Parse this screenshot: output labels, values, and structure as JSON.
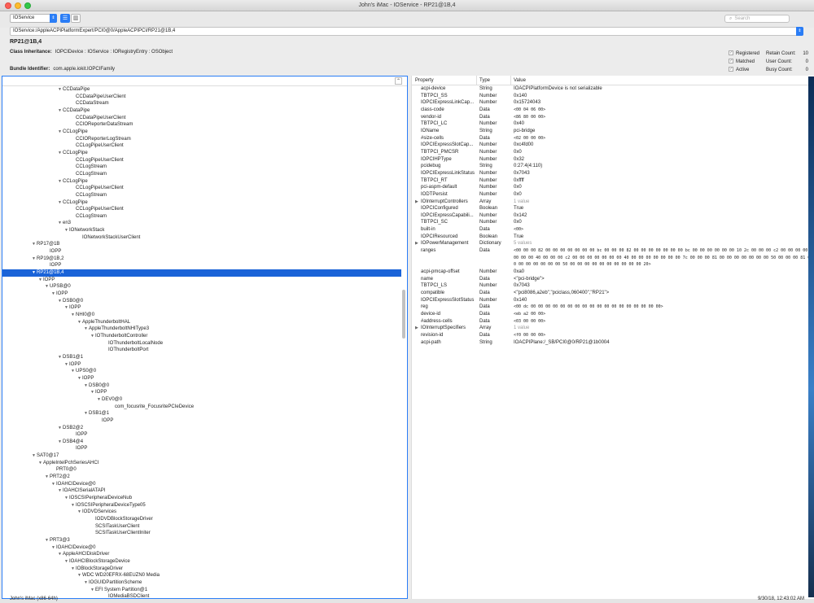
{
  "window": {
    "title": "John's iMac - IOService - RP21@1B,4"
  },
  "toolbar": {
    "plane_value": "IOService",
    "search_placeholder": "Search"
  },
  "path": "IOService:/AppleACPIPlatformExpert/PCI0@0/AppleACPIPCI/RP21@1B,4",
  "info": {
    "title": "RP21@1B,4",
    "class_label": "Class Inheritance:",
    "class_value": "IOPCIDevice : IOService : IORegistryEntry : OSObject",
    "bundle_label": "Bundle Identifier:",
    "bundle_value": "com.apple.iokit.IOPCIFamily",
    "flags": [
      "Registered",
      "Matched",
      "Active"
    ],
    "counts": [
      {
        "label": "Retain Count:",
        "value": "10"
      },
      {
        "label": "User Count:",
        "value": "0"
      },
      {
        "label": "Busy Count:",
        "value": "0"
      }
    ]
  },
  "tree": [
    {
      "d": 9,
      "t": "▼",
      "label": "CCDataPipe"
    },
    {
      "d": 11,
      "t": "",
      "label": "CCDataPipeUserClient"
    },
    {
      "d": 11,
      "t": "",
      "label": "CCDataStream"
    },
    {
      "d": 9,
      "t": "▼",
      "label": "CCDataPipe"
    },
    {
      "d": 11,
      "t": "",
      "label": "CCDataPipeUserClient"
    },
    {
      "d": 11,
      "t": "",
      "label": "CCIOReporterDataStream"
    },
    {
      "d": 9,
      "t": "▼",
      "label": "CCLogPipe"
    },
    {
      "d": 11,
      "t": "",
      "label": "CCIOReporterLogStream"
    },
    {
      "d": 11,
      "t": "",
      "label": "CCLogPipeUserClient"
    },
    {
      "d": 9,
      "t": "▼",
      "label": "CCLogPipe"
    },
    {
      "d": 11,
      "t": "",
      "label": "CCLogPipeUserClient"
    },
    {
      "d": 11,
      "t": "",
      "label": "CCLogStream"
    },
    {
      "d": 11,
      "t": "",
      "label": "CCLogStream"
    },
    {
      "d": 9,
      "t": "▼",
      "label": "CCLogPipe"
    },
    {
      "d": 11,
      "t": "",
      "label": "CCLogPipeUserClient"
    },
    {
      "d": 11,
      "t": "",
      "label": "CCLogStream"
    },
    {
      "d": 9,
      "t": "▼",
      "label": "CCLogPipe"
    },
    {
      "d": 11,
      "t": "",
      "label": "CCLogPipeUserClient"
    },
    {
      "d": 11,
      "t": "",
      "label": "CCLogStream"
    },
    {
      "d": 9,
      "t": "▼",
      "label": "en3"
    },
    {
      "d": 10,
      "t": "▼",
      "label": "IONetworkStack"
    },
    {
      "d": 12,
      "t": "",
      "label": "IONetworkStackUserClient"
    },
    {
      "d": 5,
      "t": "▼",
      "label": "RP17@1B"
    },
    {
      "d": 7,
      "t": "",
      "label": "IOPP"
    },
    {
      "d": 5,
      "t": "▼",
      "label": "RP19@1B,2"
    },
    {
      "d": 7,
      "t": "",
      "label": "IOPP"
    },
    {
      "d": 5,
      "t": "▼",
      "label": "RP21@1B,4",
      "sel": true
    },
    {
      "d": 6,
      "t": "▼",
      "label": "IOPP"
    },
    {
      "d": 7,
      "t": "▼",
      "label": "UPSB@0"
    },
    {
      "d": 8,
      "t": "▼",
      "label": "IOPP"
    },
    {
      "d": 9,
      "t": "▼",
      "label": "DSB0@0"
    },
    {
      "d": 10,
      "t": "▼",
      "label": "IOPP"
    },
    {
      "d": 11,
      "t": "▼",
      "label": "NHI0@0"
    },
    {
      "d": 12,
      "t": "▼",
      "label": "AppleThunderboltHAL"
    },
    {
      "d": 13,
      "t": "▼",
      "label": "AppleThunderboltNHIType3"
    },
    {
      "d": 14,
      "t": "▼",
      "label": "IOThunderboltController"
    },
    {
      "d": 16,
      "t": "",
      "label": "IOThunderboltLocalNode"
    },
    {
      "d": 16,
      "t": "",
      "label": "IOThunderboltPort"
    },
    {
      "d": 9,
      "t": "▼",
      "label": "DSB1@1"
    },
    {
      "d": 10,
      "t": "▼",
      "label": "IOPP"
    },
    {
      "d": 11,
      "t": "▼",
      "label": "UPS0@0"
    },
    {
      "d": 12,
      "t": "▼",
      "label": "IOPP"
    },
    {
      "d": 13,
      "t": "▼",
      "label": "DSB0@0"
    },
    {
      "d": 14,
      "t": "▼",
      "label": "IOPP"
    },
    {
      "d": 15,
      "t": "▼",
      "label": "DEV0@0"
    },
    {
      "d": 17,
      "t": "",
      "label": "com_focusrite_FocusritePCIeDevice"
    },
    {
      "d": 13,
      "t": "▼",
      "label": "DSB1@1"
    },
    {
      "d": 15,
      "t": "",
      "label": "IOPP"
    },
    {
      "d": 9,
      "t": "▼",
      "label": "DSB2@2"
    },
    {
      "d": 11,
      "t": "",
      "label": "IOPP"
    },
    {
      "d": 9,
      "t": "▼",
      "label": "DSB4@4"
    },
    {
      "d": 11,
      "t": "",
      "label": "IOPP"
    },
    {
      "d": 5,
      "t": "▼",
      "label": "SAT0@17"
    },
    {
      "d": 6,
      "t": "▼",
      "label": "AppleIntelPchSeriesAHCI"
    },
    {
      "d": 8,
      "t": "",
      "label": "PRT0@0"
    },
    {
      "d": 7,
      "t": "▼",
      "label": "PRT2@2"
    },
    {
      "d": 8,
      "t": "▼",
      "label": "IOAHCIDevice@0"
    },
    {
      "d": 9,
      "t": "▼",
      "label": "IOAHCISerialATAPI"
    },
    {
      "d": 10,
      "t": "▼",
      "label": "IOSCSIPeripheralDeviceNub"
    },
    {
      "d": 11,
      "t": "▼",
      "label": "IOSCSIPeripheralDeviceType05"
    },
    {
      "d": 12,
      "t": "▼",
      "label": "IODVDServices"
    },
    {
      "d": 14,
      "t": "",
      "label": "IODVDBlockStorageDriver"
    },
    {
      "d": 14,
      "t": "",
      "label": "SCSITaskUserClient"
    },
    {
      "d": 14,
      "t": "",
      "label": "SCSITaskUserClientIniter"
    },
    {
      "d": 7,
      "t": "▼",
      "label": "PRT3@3"
    },
    {
      "d": 8,
      "t": "▼",
      "label": "IOAHCIDevice@0"
    },
    {
      "d": 9,
      "t": "▼",
      "label": "AppleAHCIDiskDriver"
    },
    {
      "d": 10,
      "t": "▼",
      "label": "IOAHCIBlockStorageDevice"
    },
    {
      "d": 11,
      "t": "▼",
      "label": "IOBlockStorageDriver"
    },
    {
      "d": 12,
      "t": "▼",
      "label": "WDC WD20EFRX-68EUZN0 Media"
    },
    {
      "d": 13,
      "t": "▼",
      "label": "IOGUIDPartitionScheme"
    },
    {
      "d": 14,
      "t": "▼",
      "label": "EFI System Partition@1"
    },
    {
      "d": 16,
      "t": "",
      "label": "IOMediaBSDClient"
    }
  ],
  "props_header": {
    "property": "Property",
    "type": "Type",
    "value": "Value"
  },
  "props": [
    {
      "p": "acpi-device",
      "t": "String",
      "v": "IOACPIPlatformDevice is not serializable",
      "nm": true
    },
    {
      "p": "TBTPCI_SS",
      "t": "Number",
      "v": "0x140",
      "nm": true
    },
    {
      "p": "IOPCIExpressLinkCap...",
      "t": "Number",
      "v": "0x15724043",
      "nm": true
    },
    {
      "p": "class-code",
      "t": "Data",
      "v": "<00 04 06 00>"
    },
    {
      "p": "vendor-id",
      "t": "Data",
      "v": "<86 80 00 00>"
    },
    {
      "p": "TBTPCI_LC",
      "t": "Number",
      "v": "0x40",
      "nm": true
    },
    {
      "p": "IOName",
      "t": "String",
      "v": "pci-bridge",
      "nm": true
    },
    {
      "p": "#size-cells",
      "t": "Data",
      "v": "<02 00 00 00>"
    },
    {
      "p": "IOPCIExpressSlotCap...",
      "t": "Number",
      "v": "0xc4fd00",
      "nm": true
    },
    {
      "p": "TBTPCI_PMCSR",
      "t": "Number",
      "v": "0x0",
      "nm": true
    },
    {
      "p": "IOPCIHPType",
      "t": "Number",
      "v": "0x32",
      "nm": true
    },
    {
      "p": "pcidebug",
      "t": "String",
      "v": "0:27:4(4:110)",
      "nm": true
    },
    {
      "p": "IOPCIExpressLinkStatus",
      "t": "Number",
      "v": "0x7043",
      "nm": true
    },
    {
      "p": "TBTPCI_RT",
      "t": "Number",
      "v": "0xffff",
      "nm": true
    },
    {
      "p": "pci-aspm-default",
      "t": "Number",
      "v": "0x0",
      "nm": true
    },
    {
      "p": "IODTPersist",
      "t": "Number",
      "v": "0x0",
      "nm": true
    },
    {
      "p": "IOInterruptControllers",
      "t": "Array",
      "v": "1 value",
      "nm": true,
      "grey": true,
      "tri": true
    },
    {
      "p": "IOPCIConfigured",
      "t": "Boolean",
      "v": "True",
      "nm": true
    },
    {
      "p": "IOPCIExpressCapabili...",
      "t": "Number",
      "v": "0x142",
      "nm": true
    },
    {
      "p": "TBTPCI_SC",
      "t": "Number",
      "v": "0x0",
      "nm": true
    },
    {
      "p": "built-in",
      "t": "Data",
      "v": "<00>"
    },
    {
      "p": "IOPCIResourced",
      "t": "Boolean",
      "v": "True",
      "nm": true
    },
    {
      "p": "IOPowerManagement",
      "t": "Dictionary",
      "v": "5 values",
      "nm": true,
      "grey": true,
      "tri": true
    },
    {
      "p": "ranges",
      "t": "Data",
      "v": "<00 00 00 82 00 00 00 00 00 00 00 bc 00 00 00 82 00 00 00 00 00 00 00 bc 00 00 00 00 00 00 10 2c 00 00 00 c2 00 00 00 00 00 00 00 40 00 00 00 c2 00 00 00 00 00 00 00 40 00 00 00 00 00 00 00 7c 00 00 00 81 00 00 00 00 00 00 00 50 00 00 00 81 00 00 00 00 00 00 00 50 00 00 00 00 00 00 00 00 00 00 20>"
    },
    {
      "p": "acpi-pmcap-offset",
      "t": "Number",
      "v": "0xa0",
      "nm": true
    },
    {
      "p": "name",
      "t": "Data",
      "v": "<\"pci-bridge\">",
      "nm": true
    },
    {
      "p": "TBTPCI_LS",
      "t": "Number",
      "v": "0x7043",
      "nm": true
    },
    {
      "p": "compatible",
      "t": "Data",
      "v": "<\"pci8086,a2eb\",\"pciclass,060400\",\"RP21\">",
      "nm": true
    },
    {
      "p": "IOPCIExpressSlotStatus",
      "t": "Number",
      "v": "0x140",
      "nm": true
    },
    {
      "p": "reg",
      "t": "Data",
      "v": "<00 dc 00 00 00 00 00 00 00 00 00 00 00 00 00 00 00 00 00 00>"
    },
    {
      "p": "device-id",
      "t": "Data",
      "v": "<eb a2 00 00>"
    },
    {
      "p": "#address-cells",
      "t": "Data",
      "v": "<03 00 00 00>"
    },
    {
      "p": "IOInterruptSpecifiers",
      "t": "Array",
      "v": "1 value",
      "nm": true,
      "grey": true,
      "tri": true
    },
    {
      "p": "revision-id",
      "t": "Data",
      "v": "<f0 00 00 00>"
    },
    {
      "p": "acpi-path",
      "t": "String",
      "v": "IOACPIPlane:/_SB/PCI0@0/RP21@1b0004",
      "nm": true
    }
  ],
  "status": {
    "left": "John's iMac (x86-64h)",
    "right": "9/30/18, 12:43:02 AM"
  }
}
